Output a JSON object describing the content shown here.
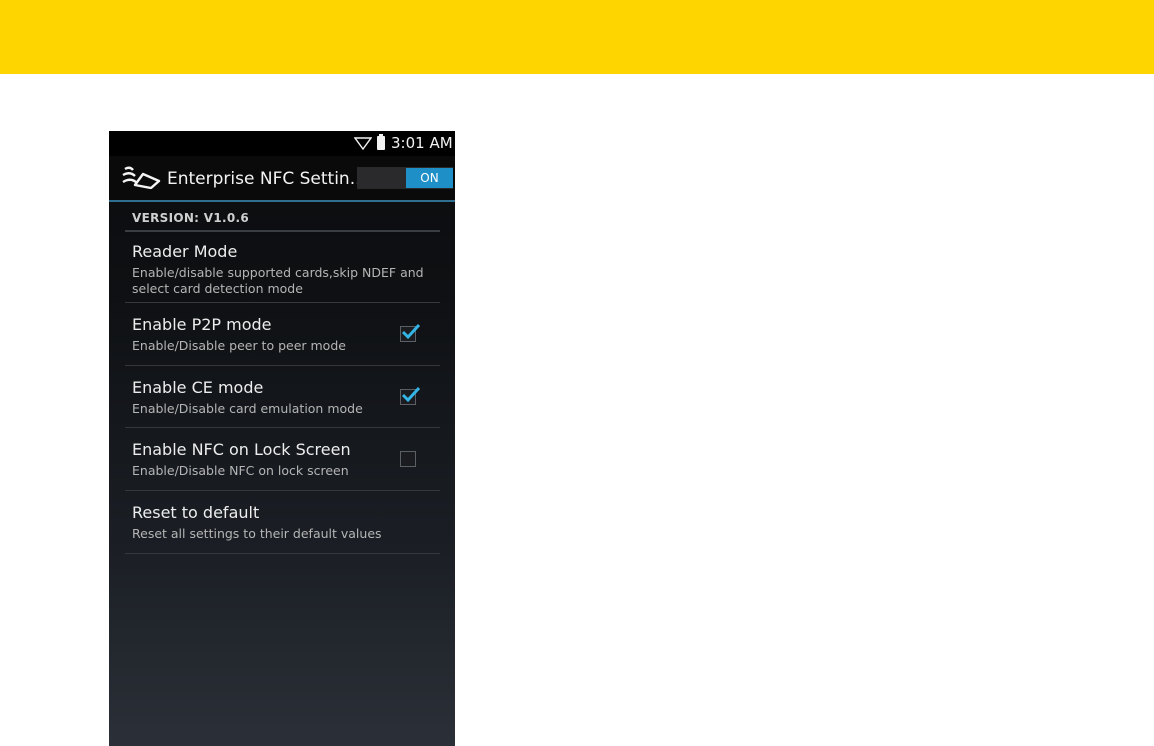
{
  "status_bar": {
    "time": "3:01 AM",
    "icons": [
      "wifi-icon",
      "battery-icon"
    ]
  },
  "action_bar": {
    "icon": "nfc-icon",
    "title": "Enterprise NFC Settin...",
    "toggle_label": "ON",
    "toggle_state": true
  },
  "version_label": "VERSION: V1.0.6",
  "preferences": [
    {
      "title": "Reader Mode",
      "summary": "Enable/disable supported cards,skip NDEF and select card detection mode"
    },
    {
      "title": "Enable P2P mode",
      "summary": "Enable/Disable peer to peer mode",
      "checked": true
    },
    {
      "title": "Enable CE mode",
      "summary": "Enable/Disable card emulation mode",
      "checked": true
    },
    {
      "title": "Enable NFC on Lock Screen",
      "summary": "Enable/Disable NFC on lock screen",
      "checked": false
    },
    {
      "title": "Reset to default",
      "summary": "Reset all settings to their default values"
    }
  ],
  "colors": {
    "top_band": "#ffd500",
    "accent": "#1f8fc8",
    "background": "#0e1013"
  }
}
